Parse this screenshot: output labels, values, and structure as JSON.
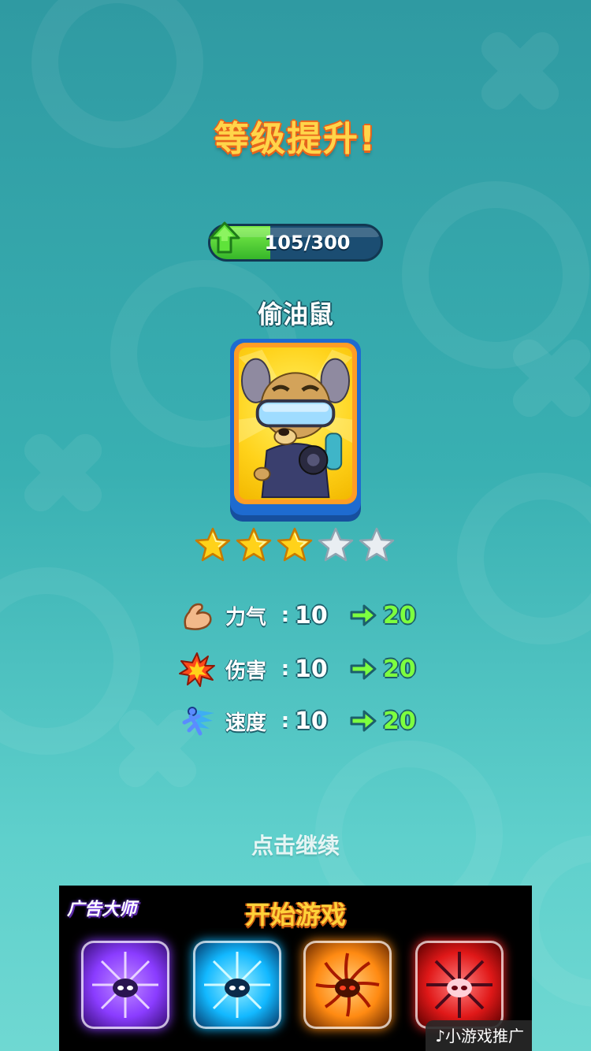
{
  "title": "等级提升!",
  "xp": {
    "text": "105/300",
    "current": 105,
    "max": 300
  },
  "character": {
    "name": "偷油鼠",
    "stars_filled": 3,
    "stars_total": 5
  },
  "stats": [
    {
      "icon": "muscle-icon",
      "label": "力气",
      "colon": ":",
      "value": "10",
      "new_value": "20"
    },
    {
      "icon": "explosion-icon",
      "label": "伤害",
      "colon": ":",
      "value": "10",
      "new_value": "20"
    },
    {
      "icon": "runner-icon",
      "label": "速度",
      "colon": ":",
      "value": "10",
      "new_value": "20"
    }
  ],
  "continue_label": "点击继续",
  "ad": {
    "logo_text": "广告大师",
    "start_label": "开始游戏",
    "tiles": [
      {
        "name": "purple-skill-icon",
        "color": "#8a3cff"
      },
      {
        "name": "blue-skill-icon",
        "color": "#12b8ff"
      },
      {
        "name": "orange-skill-icon",
        "color": "#ff8a12"
      },
      {
        "name": "red-skill-icon",
        "color": "#ff2a2a"
      }
    ],
    "tag": "小游戏推广"
  },
  "colors": {
    "accent_green": "#7dff3f",
    "title_yellow": "#ffd54a",
    "card_blue": "#1e6bd0"
  }
}
